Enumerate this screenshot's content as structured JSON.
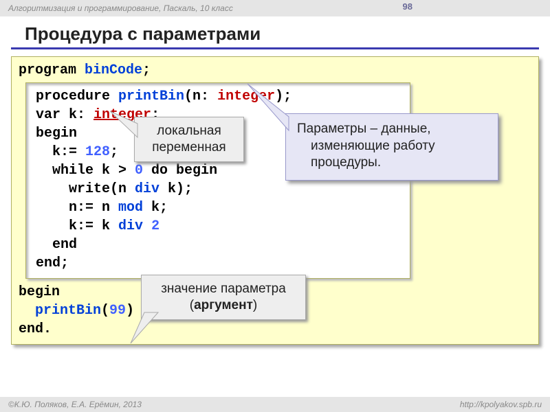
{
  "header": {
    "course": "Алгоритмизация и программирование, Паскаль, 10 класс",
    "page": "98"
  },
  "title": "Процедура с параметрами",
  "code": {
    "l1a": "program ",
    "l1b": "binCode",
    "l1c": ";",
    "p1a": "procedure ",
    "p1b": "printBin",
    "p1c": "(n: ",
    "p1d": "integer",
    "p1e": ");",
    "p2a": "var k: ",
    "p2b": "integer",
    "p2c": ";",
    "p3": "begin",
    "p4a": "  k:= ",
    "p4b": "128",
    "p4c": ";",
    "p5a": "  while k > ",
    "p5b": "0",
    "p5c": " do begin",
    "p6a": "    write(n ",
    "p6b": "div",
    "p6c": " k);",
    "p7a": "    n:= n ",
    "p7b": "mod",
    "p7c": " k;",
    "p8a": "    k:= k ",
    "p8b": "div",
    "p8c": " ",
    "p8d": "2",
    "p9": "  end",
    "p10": "end;",
    "m1": "begin",
    "m2a": "  ",
    "m2b": "printBin",
    "m2c": "(",
    "m2d": "99",
    "m2e": ")",
    "m3": "end."
  },
  "callout_local": {
    "line1": "локальная",
    "line2": "переменная"
  },
  "callout_param": {
    "strong": "Параметры",
    "rest1": " – данные,",
    "rest2": "изменяющие работу",
    "rest3": "процедуры."
  },
  "callout_arg": {
    "line1": "значение параметра",
    "line2a": "(",
    "line2b": "аргумент",
    "line2c": ")"
  },
  "footer": {
    "left": "К.Ю. Поляков, Е.А. Ерёмин, 2013",
    "right": "http://kpolyakov.spb.ru"
  }
}
